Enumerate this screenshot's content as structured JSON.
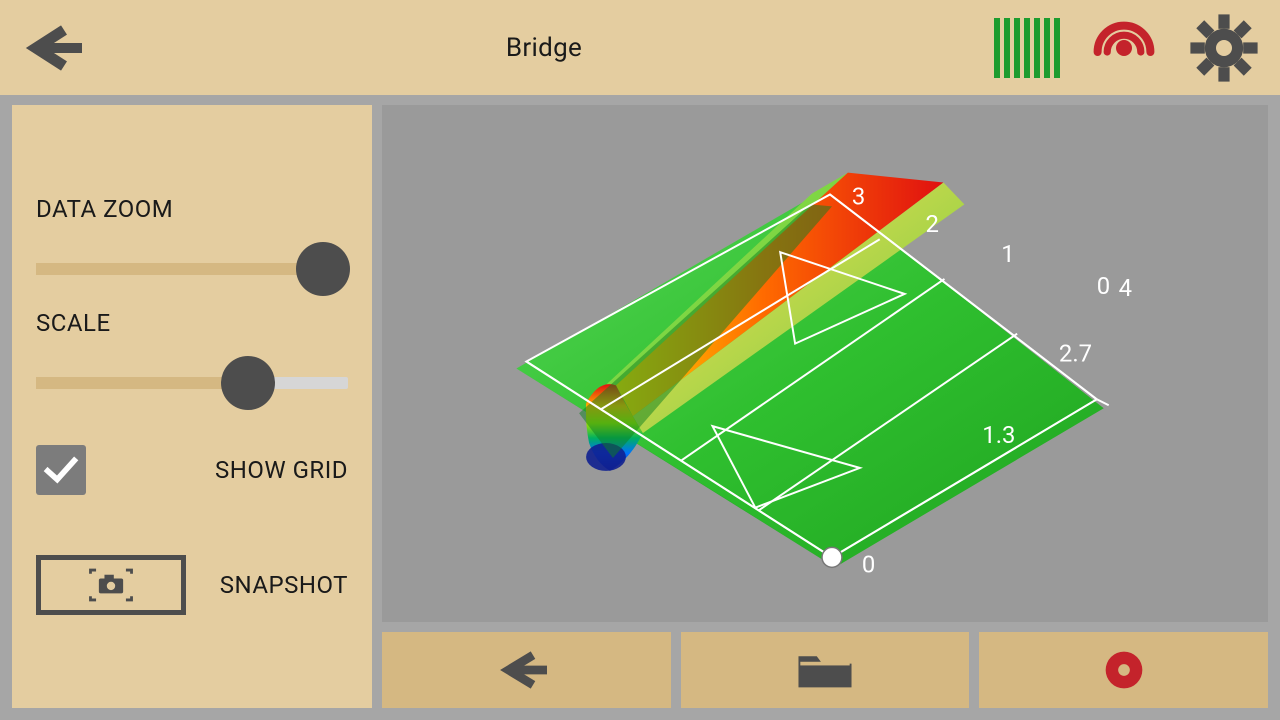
{
  "header": {
    "title": "Bridge"
  },
  "sidebar": {
    "data_zoom_label": "DATA ZOOM",
    "data_zoom_percent": 92,
    "scale_label": "SCALE",
    "scale_percent": 68,
    "show_grid_label": "SHOW GRID",
    "show_grid_checked": true,
    "snapshot_label": "SNAPSHOT"
  },
  "icons": {
    "back": "arrow-left-icon",
    "signal": "signal-bars-icon",
    "target": "target-icon",
    "gear": "gear-icon",
    "toolbar_back": "arrow-left-icon",
    "folder": "folder-icon",
    "record": "record-icon",
    "camera": "camera-icon",
    "check": "check-icon"
  },
  "colors": {
    "accent_green": "#1d9c2f",
    "accent_red": "#c4232b",
    "panel_beige": "#e4cda0",
    "button_beige": "#d5b882",
    "neutral_dark": "#4d4d4d"
  },
  "chart_data": {
    "type": "surface3d",
    "description": "Ground-penetrating radar 3D ridge surface",
    "axis1": {
      "ticks": [
        0,
        1,
        2,
        3
      ],
      "range": [
        0,
        3
      ]
    },
    "axis2": {
      "ticks": [
        0,
        1.3,
        2.7,
        4
      ],
      "range": [
        0,
        4
      ]
    },
    "ridge": {
      "position_on_axis1": 2,
      "orientation": "parallel_to_axis2",
      "peak_value": 1.0,
      "dip_value": -0.6,
      "colors_low_to_high": [
        "#1030ff",
        "#00d020",
        "#ffe000",
        "#ff6a00",
        "#e01010"
      ]
    },
    "base_plane_color": "#2fbf2f",
    "triangle_markers": 2,
    "marker_dot": {
      "axis1": 0,
      "axis2": 0
    },
    "grid_visible": true
  }
}
